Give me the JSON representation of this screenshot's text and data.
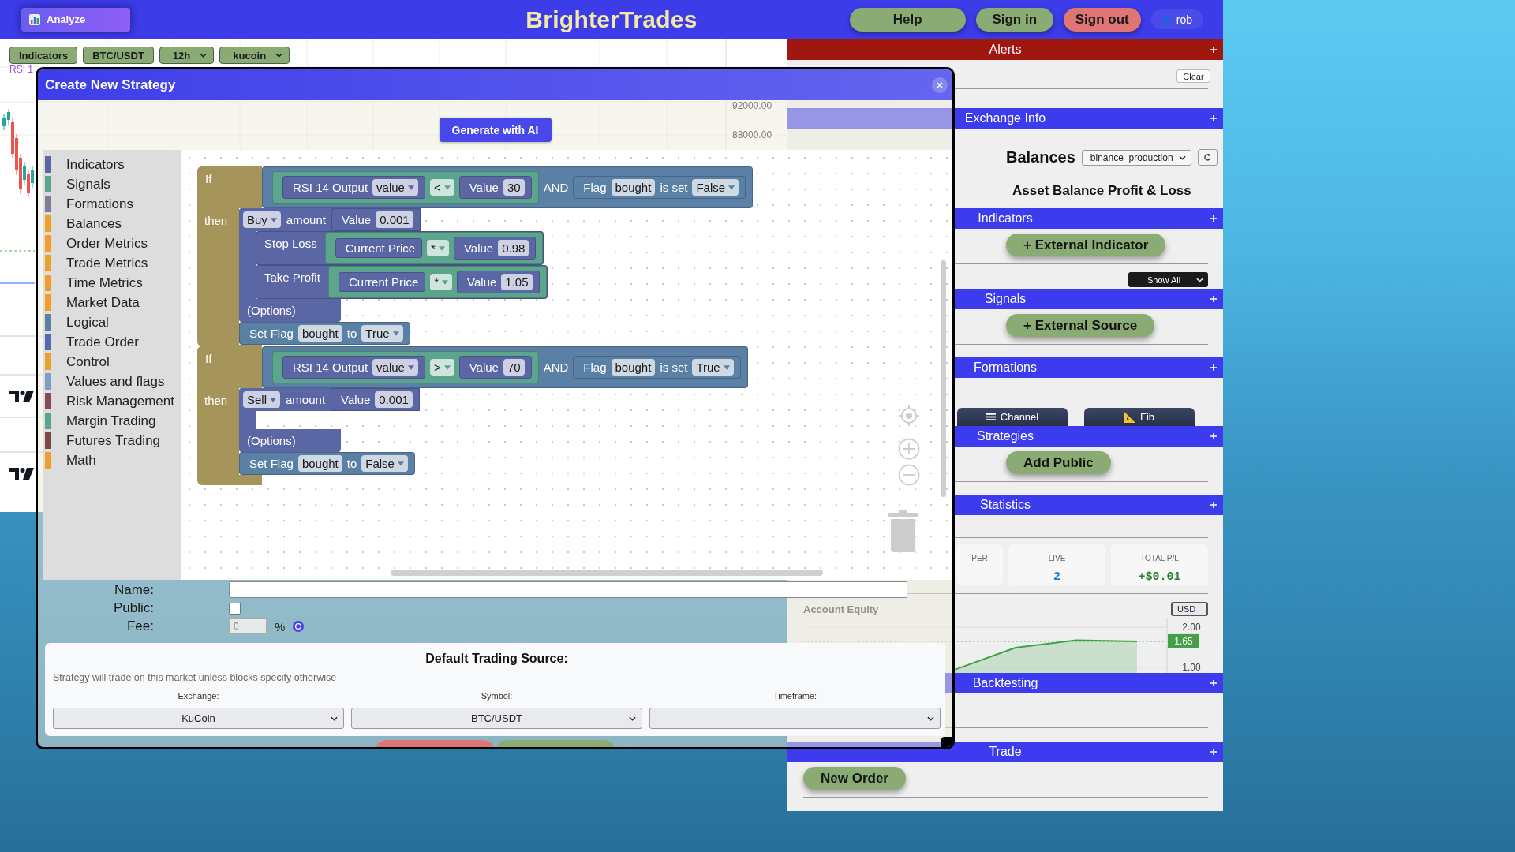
{
  "header": {
    "analyze_button": "Analyze",
    "title": "BrighterTrades",
    "buttons": [
      {
        "label": "Help",
        "color": "#8aab74"
      },
      {
        "label": "Sign in",
        "color": "#8aab74"
      },
      {
        "label": "Sign out",
        "color": "#e07575"
      }
    ],
    "user": "rob"
  },
  "chart": {
    "toolbar": [
      {
        "kind": "button",
        "label": "Indicators"
      },
      {
        "kind": "button",
        "label": "BTC/USDT"
      },
      {
        "kind": "select",
        "label": "12h"
      },
      {
        "kind": "select",
        "label": "kucoin"
      }
    ],
    "legend": "RSI 1",
    "price_labels": [
      "92000.00",
      "88000.00"
    ]
  },
  "side_panel": {
    "sections": [
      {
        "kind": "alerts",
        "title": "Alerts",
        "color": "#a0170f",
        "clear_button": "Clear"
      },
      {
        "kind": "exchange_info",
        "title": "Exchange Info",
        "color": "#3c3cee",
        "balances_label": "Balances",
        "account_select": "binance_production",
        "table_title": "Asset Balance Profit & Loss"
      },
      {
        "kind": "indicators",
        "title": "Indicators",
        "color": "#3c3cee",
        "add_button": "+ External Indicator",
        "filter_select": "Show All"
      },
      {
        "kind": "signals",
        "title": "Signals",
        "color": "#3c3cee",
        "add_button": "+ External Source"
      },
      {
        "kind": "formations",
        "title": "Formations",
        "color": "#3c3cee",
        "tools": [
          {
            "kind": "channel",
            "label": "Channel"
          },
          {
            "kind": "fib",
            "label": "Fib"
          }
        ]
      },
      {
        "kind": "strategies",
        "title": "Strategies",
        "color": "#3c3cee",
        "add_button": "Add Public"
      },
      {
        "kind": "statistics",
        "title": "Statistics",
        "color": "#3c3cee",
        "stats": [
          {
            "label": "PER"
          },
          {
            "label": "LIVE",
            "value": "2",
            "color": "#1e7fd8"
          },
          {
            "label": "TOTAL P/L",
            "value": "+$0.01",
            "color": "#2e7d32"
          }
        ],
        "currency_select": "USD",
        "chart_data": {
          "type": "area",
          "title": "Account Equity",
          "values": [
            0.94,
            1.49,
            1.68,
            1.65
          ],
          "ylim": [
            0.86,
            2.22
          ],
          "yticks": [
            {
              "value": 2,
              "label": "2.00"
            },
            {
              "value": 1,
              "label": "1.00"
            }
          ],
          "ref_lines": [
            {
              "axis": "y",
              "value": 1.65,
              "label": "1.65"
            }
          ]
        }
      },
      {
        "kind": "backtesting",
        "title": "Backtesting",
        "color": "#3c3cee"
      },
      {
        "kind": "trade",
        "title": "Trade",
        "color": "#3c3cee",
        "add_button": "New Order"
      }
    ]
  },
  "dialog": {
    "title": "Create New Strategy",
    "generate_button": "Generate with AI",
    "toolbox": [
      {
        "label": "Indicators",
        "color": "#5b67a5",
        "selected": false
      },
      {
        "label": "Signals",
        "color": "#5ba58c",
        "selected": false
      },
      {
        "label": "Formations",
        "color": "#7a7f99",
        "selected": false
      },
      {
        "label": "Balances",
        "color": "#eea02a",
        "selected": false
      },
      {
        "label": "Order Metrics",
        "color": "#eea02a",
        "selected": false
      },
      {
        "label": "Trade Metrics",
        "color": "#eea02a",
        "selected": false
      },
      {
        "label": "Time Metrics",
        "color": "#eea02a",
        "selected": false
      },
      {
        "label": "Market Data",
        "color": "#eea02a",
        "selected": false
      },
      {
        "label": "Logical",
        "color": "#5b80a5",
        "selected": false
      },
      {
        "label": "Trade Order",
        "color": "#5469b0",
        "selected": false
      },
      {
        "label": "Control",
        "color": "#eea02a",
        "selected": false
      },
      {
        "label": "Values and flags",
        "color": "#7e9dc9",
        "selected": false
      },
      {
        "label": "Risk Management",
        "color": "#8a4a55",
        "selected": false
      },
      {
        "label": "Margin Trading",
        "color": "#5ba58c",
        "selected": false
      },
      {
        "label": "Futures Trading",
        "color": "#7d4848",
        "selected": false
      },
      {
        "label": "Math",
        "color": "#eea02a",
        "selected": false
      }
    ],
    "blocks": [
      {
        "kind": "if",
        "color": "#a5955b",
        "if_label": "If",
        "then_label": "then",
        "condition": {
          "kind": "block",
          "color": "#5b80a5",
          "parts": [
            {
              "kind": "block",
              "color": "#5ba58c",
              "parts": [
                {
                  "kind": "block",
                  "color": "#5b67a5",
                  "parts": [
                    {
                      "kind": "label",
                      "text": "RSI 14 Output"
                    },
                    {
                      "kind": "dropdown",
                      "text": "value"
                    }
                  ]
                },
                {
                  "kind": "dropdown",
                  "text": "<"
                },
                {
                  "kind": "block",
                  "color": "#5b67a5",
                  "parts": [
                    {
                      "kind": "label",
                      "text": "Value"
                    },
                    {
                      "kind": "field",
                      "text": "30"
                    }
                  ]
                }
              ]
            },
            {
              "kind": "label",
              "text": "AND"
            },
            {
              "kind": "block",
              "color": "#5b80a5",
              "parts": [
                {
                  "kind": "label",
                  "text": "Flag"
                },
                {
                  "kind": "field",
                  "text": "bought"
                },
                {
                  "kind": "label",
                  "text": "is set"
                },
                {
                  "kind": "dropdown",
                  "text": "False"
                }
              ]
            }
          ]
        },
        "statements": [
          {
            "kind": "action",
            "color": "#5b67a5",
            "parts": [
              {
                "kind": "dropdown",
                "text": "Buy"
              },
              {
                "kind": "label",
                "text": "amount"
              },
              {
                "kind": "block",
                "color": "#5b67a5",
                "parts": [
                  {
                    "kind": "label",
                    "text": "Value"
                  },
                  {
                    "kind": "field",
                    "text": "0.001"
                  }
                ]
              }
            ],
            "statements": [
              {
                "kind": "input",
                "color": "#5b67a5",
                "label": "Stop Loss",
                "input": {
                  "kind": "block",
                  "color": "#5ba58c",
                  "parts": [
                    {
                      "kind": "block",
                      "color": "#5b67a5",
                      "parts": [
                        {
                          "kind": "label",
                          "text": "Current Price"
                        }
                      ]
                    },
                    {
                      "kind": "dropdown",
                      "text": "*"
                    },
                    {
                      "kind": "block",
                      "color": "#5b67a5",
                      "parts": [
                        {
                          "kind": "label",
                          "text": "Value"
                        },
                        {
                          "kind": "field",
                          "text": "0.98"
                        }
                      ]
                    }
                  ]
                }
              },
              {
                "kind": "input",
                "color": "#5b67a5",
                "label": "Take Profit",
                "input": {
                  "kind": "block",
                  "color": "#5ba58c",
                  "parts": [
                    {
                      "kind": "block",
                      "color": "#5b67a5",
                      "parts": [
                        {
                          "kind": "label",
                          "text": "Current Price"
                        }
                      ]
                    },
                    {
                      "kind": "dropdown",
                      "text": "*"
                    },
                    {
                      "kind": "block",
                      "color": "#5b67a5",
                      "parts": [
                        {
                          "kind": "label",
                          "text": "Value"
                        },
                        {
                          "kind": "field",
                          "text": "1.05"
                        }
                      ]
                    }
                  ]
                }
              }
            ],
            "footer": "(Options)"
          },
          {
            "kind": "block",
            "color": "#5b80a5",
            "parts": [
              {
                "kind": "label",
                "text": "Set Flag"
              },
              {
                "kind": "field",
                "text": "bought"
              },
              {
                "kind": "label",
                "text": "to"
              },
              {
                "kind": "dropdown",
                "text": "True"
              }
            ]
          }
        ]
      },
      {
        "kind": "if",
        "color": "#a5955b",
        "if_label": "If",
        "then_label": "then",
        "condition": {
          "kind": "block",
          "color": "#5b80a5",
          "parts": [
            {
              "kind": "block",
              "color": "#5ba58c",
              "parts": [
                {
                  "kind": "block",
                  "color": "#5b67a5",
                  "parts": [
                    {
                      "kind": "label",
                      "text": "RSI 14 Output"
                    },
                    {
                      "kind": "dropdown",
                      "text": "value"
                    }
                  ]
                },
                {
                  "kind": "dropdown",
                  "text": ">"
                },
                {
                  "kind": "block",
                  "color": "#5b67a5",
                  "parts": [
                    {
                      "kind": "label",
                      "text": "Value"
                    },
                    {
                      "kind": "field",
                      "text": "70"
                    }
                  ]
                }
              ]
            },
            {
              "kind": "label",
              "text": "AND"
            },
            {
              "kind": "block",
              "color": "#5b80a5",
              "parts": [
                {
                  "kind": "label",
                  "text": "Flag"
                },
                {
                  "kind": "field",
                  "text": "bought"
                },
                {
                  "kind": "label",
                  "text": "is set"
                },
                {
                  "kind": "dropdown",
                  "text": "True"
                }
              ]
            }
          ]
        },
        "statements": [
          {
            "kind": "action",
            "color": "#5b67a5",
            "parts": [
              {
                "kind": "dropdown",
                "text": "Sell"
              },
              {
                "kind": "label",
                "text": "amount"
              },
              {
                "kind": "block",
                "color": "#5b67a5",
                "parts": [
                  {
                    "kind": "label",
                    "text": "Value"
                  },
                  {
                    "kind": "field",
                    "text": "0.001"
                  }
                ]
              }
            ],
            "footer": "(Options)"
          },
          {
            "kind": "block",
            "color": "#5b80a5",
            "parts": [
              {
                "kind": "label",
                "text": "Set Flag"
              },
              {
                "kind": "field",
                "text": "bought"
              },
              {
                "kind": "label",
                "text": "to"
              },
              {
                "kind": "dropdown",
                "text": "False"
              }
            ]
          }
        ]
      }
    ],
    "form": {
      "fields": [
        {
          "kind": "text",
          "label": "Name:"
        },
        {
          "kind": "checkbox",
          "label": "Public:",
          "checked": false
        },
        {
          "kind": "number",
          "label": "Fee:",
          "placeholder": "0",
          "unit": "%"
        }
      ]
    },
    "trading_source": {
      "title": "Default Trading Source:",
      "note": "Strategy will trade on this market unless blocks specify otherwise",
      "selects": [
        {
          "label": "Exchange:",
          "value": "KuCoin"
        },
        {
          "label": "Symbol:",
          "value": "BTC/USDT"
        },
        {
          "label": "Timeframe:"
        }
      ]
    },
    "footer_buttons": [
      {
        "color": "#e07575"
      },
      {
        "color": "#8aab74"
      }
    ]
  }
}
